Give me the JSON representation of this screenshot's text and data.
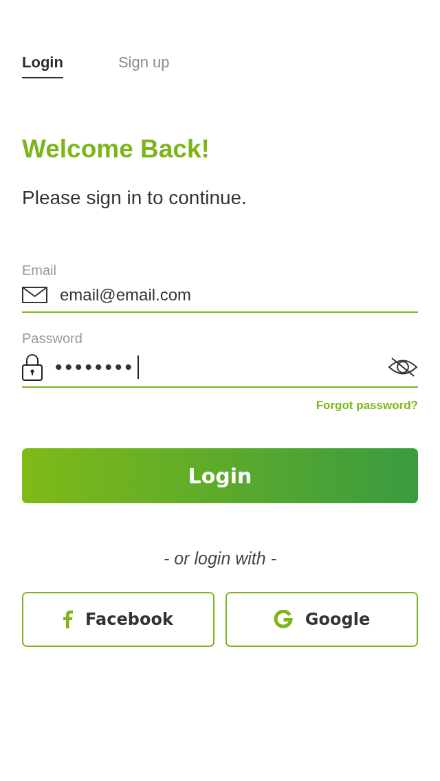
{
  "tabs": [
    {
      "label": "Login",
      "selected": true
    },
    {
      "label": "Sign up",
      "selected": false
    }
  ],
  "heading": "Welcome Back!",
  "subtitle": "Please sign in to continue.",
  "fields": [
    {
      "kind": "email",
      "label": "Email",
      "value": "email@email.com"
    },
    {
      "kind": "password",
      "label": "Password",
      "value": "••••••••",
      "focused": true,
      "password_visible": false
    }
  ],
  "forgot_link": "Forgot password?",
  "login_button": "Login",
  "divider_text": "- or login with -",
  "social_buttons": [
    {
      "kind": "facebook",
      "label": "Facebook"
    },
    {
      "kind": "google",
      "label": "Google"
    }
  ]
}
